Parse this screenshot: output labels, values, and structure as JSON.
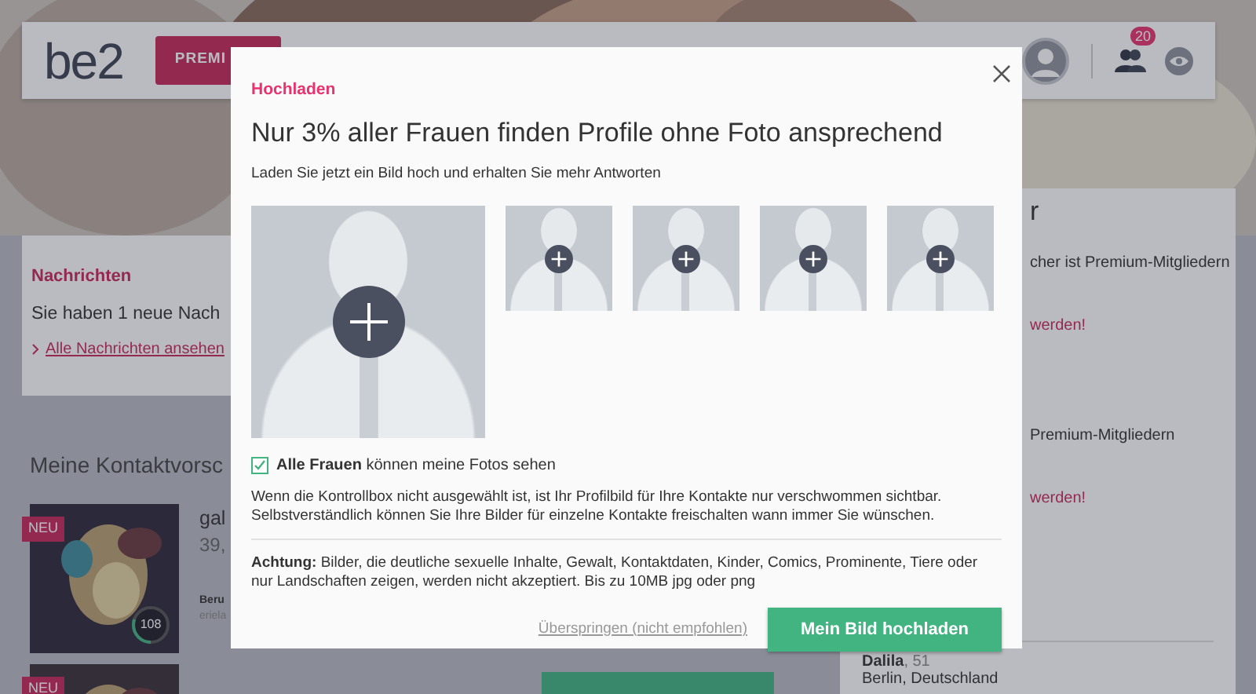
{
  "header": {
    "logo": "be2",
    "premium_button": "PREMI",
    "notification_count": "20"
  },
  "messages": {
    "title": "Nachrichten",
    "text": "Sie haben 1 neue Nach",
    "link": "Alle Nachrichten ansehen"
  },
  "suggestions": {
    "title": "Meine Kontaktvorsc",
    "cards": [
      {
        "badge": "NEU",
        "score": "108",
        "level": 0.3,
        "name": "gal",
        "age": "39,",
        "label": "Beru",
        "detail": "eriela"
      },
      {
        "badge": "NEU"
      }
    ]
  },
  "sidebar": {
    "heading": "r",
    "items": [
      {
        "text": "cher ist Premium-Mitgliedern",
        "link": "werden!"
      },
      {
        "text": "Premium-Mitgliedern",
        "link": "werden!"
      }
    ],
    "person": {
      "name": "Dalila",
      "age": ", 51",
      "location": "Berlin, Deutschland"
    }
  },
  "modal": {
    "eyebrow": "Hochladen",
    "title": "Nur 3% aller Frauen finden Profile ohne Foto ansprechend",
    "subtitle": "Laden Sie jetzt ein Bild hoch und erhalten Sie mehr Antworten",
    "photo_slots": [
      {
        "kind": "main"
      },
      {
        "kind": "small"
      },
      {
        "kind": "small"
      },
      {
        "kind": "small"
      },
      {
        "kind": "small"
      }
    ],
    "share": {
      "checked": true,
      "text": "**Alle Frauen** können meine Fotos sehen"
    },
    "info": "Wenn die Kontrollbox nicht ausgewählt ist, ist Ihr Profilbild für Ihre Kontakte nur verschwommen sichtbar. Selbstverständlich können Sie Ihre Bilder für einzelne Kontakte freischalten wann immer Sie wünschen.",
    "warning": "**Achtung:** Bilder, die deutliche sexuelle Inhalte, Gewalt, Kontaktdaten, Kinder, Comics, Prominente, Tiere oder nur Landschaften zeigen, werden nicht akzeptiert. Bis zu 10MB jpg oder png",
    "skip_link": "Überspringen (nicht empfohlen)",
    "upload_button": "Mein Bild hochladen"
  }
}
